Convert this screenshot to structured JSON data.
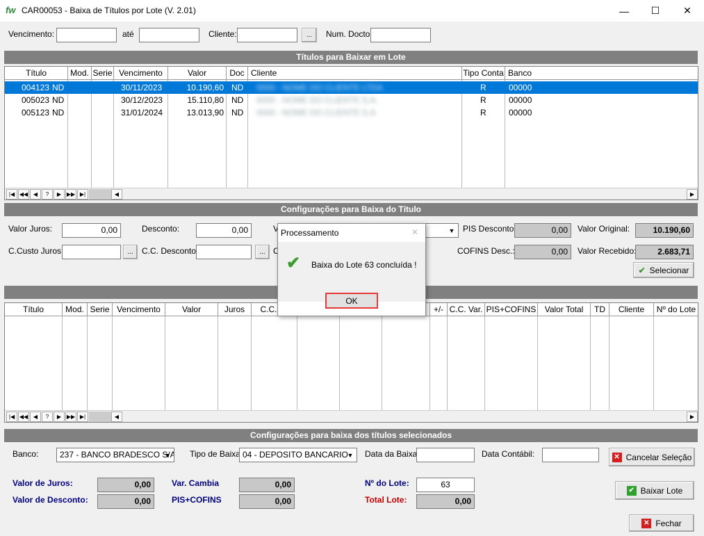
{
  "window": {
    "logo": "fw",
    "title": "CAR00053 - Baixa de Títulos por Lote   (V. 2.01)",
    "minimize": "—",
    "maximize": "☐",
    "close": "✕"
  },
  "filters": {
    "vencimento_label": "Vencimento:",
    "ate_label": "até",
    "cliente_label": "Cliente:",
    "lookup_btn": "...",
    "num_docto_label": "Num. Docto"
  },
  "titulos": {
    "header": "Títulos para Baixar em Lote",
    "columns": [
      "Título",
      "Mod.",
      "Serie",
      "Vencimento",
      "Valor",
      "Doc",
      "Cliente",
      "Tipo Conta",
      "Banco"
    ],
    "rows": [
      {
        "titulo": "004123",
        "doc_type": "ND",
        "vencimento": "30/11/2023",
        "valor": "10.190,60",
        "doc": "ND",
        "cliente": "0000 - NOME DO CLIENTE LTDA",
        "tipo": "R",
        "banco": "00000"
      },
      {
        "titulo": "005023",
        "doc_type": "ND",
        "vencimento": "30/12/2023",
        "valor": "15.110,80",
        "doc": "ND",
        "cliente": "0000 - NOME DO CLIENTE S.A.",
        "tipo": "R",
        "banco": "00000"
      },
      {
        "titulo": "005123",
        "doc_type": "ND",
        "vencimento": "31/01/2024",
        "valor": "13.013,90",
        "doc": "ND",
        "cliente": "0000 - NOME DO CLIENTE S.A.",
        "tipo": "R",
        "banco": "00000"
      }
    ]
  },
  "nav": [
    "|◀",
    "◀◀",
    "◀",
    "?",
    "▶",
    "▶▶",
    "▶|"
  ],
  "config": {
    "header": "Configurações para Baixa do Título",
    "valor_juros_label": "Valor Juros:",
    "valor_juros": "0,00",
    "desconto_label": "Desconto:",
    "desconto": "0,00",
    "v_label": "V",
    "pis_desc_label": "PIS Desconto:",
    "pis_desc": "0,00",
    "valor_original_label": "Valor Original:",
    "valor_original": "10.190,60",
    "ccusto_juros_label": "C.Custo Juros:",
    "cc_desconto_label": "C.C. Desconto:",
    "c_label": "C",
    "cofins_label": "COFINS Desc.:",
    "cofins": "0,00",
    "valor_recebido_label": "Valor Recebido:",
    "valor_recebido": "2.683,71",
    "selecionar": "Selecionar"
  },
  "selecionados": {
    "columns": [
      "Título",
      "Mod.",
      "Serie",
      "Vencimento",
      "Valor",
      "Juros",
      "C.C. Ju",
      "",
      "",
      "",
      "+/-",
      "C.C. Var.",
      "PIS+COFINS",
      "Valor Total",
      "TD",
      "Cliente",
      "Nº do Lote"
    ]
  },
  "lote": {
    "header": "Configurações para baixa dos títulos selecionados",
    "banco_label": "Banco:",
    "banco": "237 - BANCO BRADESCO S/A",
    "tipo_baixa_label": "Tipo de Baixa:",
    "tipo_baixa": "04 - DEPOSITO BANCARIO",
    "data_baixa_label": "Data da Baixa:",
    "data_contabil_label": "Data Contábil:",
    "cancelar": "Cancelar Seleção"
  },
  "totais": {
    "valor_juros_label": "Valor de Juros:",
    "valor_juros": "0,00",
    "valor_desconto_label": "Valor de Desconto:",
    "valor_desconto": "0,00",
    "var_cambia_label": "Var. Cambia",
    "var_cambia": "0,00",
    "pis_cofins_label": "PIS+COFINS",
    "pis_cofins": "0,00",
    "num_lote_label": "Nº do Lote:",
    "num_lote": "63",
    "total_lote_label": "Total Lote:",
    "total_lote": "0,00",
    "baixar_lote": "Baixar Lote",
    "fechar": "Fechar"
  },
  "dialog": {
    "title": "Processamento",
    "message": "Baixa do Lote 63 concluída !",
    "ok": "OK",
    "close": "✕"
  }
}
